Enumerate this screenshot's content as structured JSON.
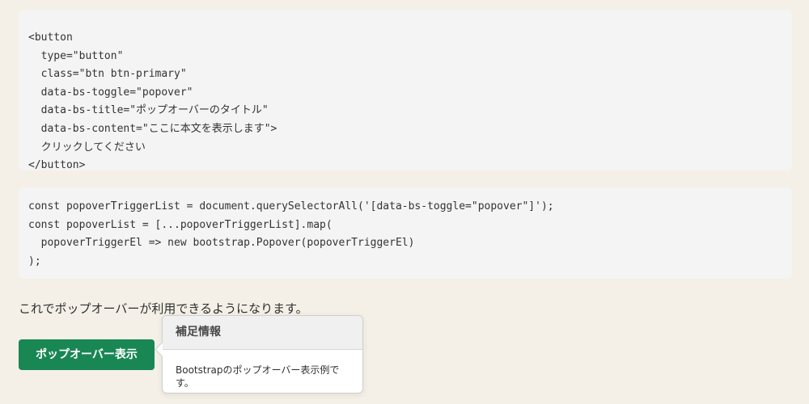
{
  "code_html": {
    "lines": [
      "<button",
      "  type=\"button\"",
      "  class=\"btn btn-primary\"",
      "  data-bs-toggle=\"popover\"",
      "  data-bs-title=\"ポップオーバーのタイトル\"",
      "  data-bs-content=\"ここに本文を表示します\">",
      "  クリックしてください",
      "</button>"
    ]
  },
  "code_js": {
    "lines": [
      "const popoverTriggerList = document.querySelectorAll('[data-bs-toggle=\"popover\"]');",
      "const popoverList = [...popoverTriggerList].map(",
      "  popoverTriggerEl => new bootstrap.Popover(popoverTriggerEl)",
      ");"
    ]
  },
  "lead": {
    "text": "これでポップオーバーが利用できるようになります。"
  },
  "demo_button": {
    "label": "ポップオーバー表示",
    "color": "#198754"
  },
  "popover": {
    "title": "補足情報",
    "body": "Bootstrapのポップオーバー表示例です。"
  }
}
